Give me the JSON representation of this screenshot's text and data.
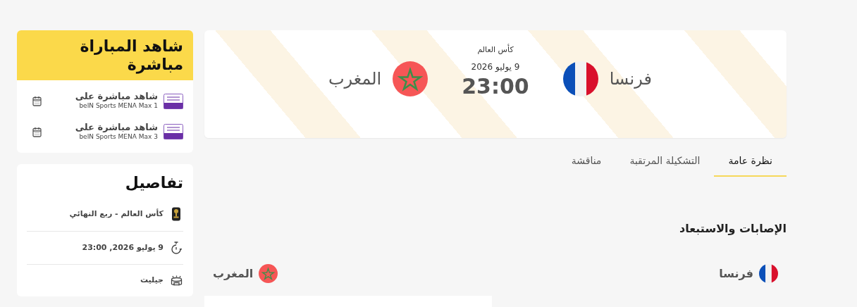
{
  "match": {
    "competition": "كأس العالم",
    "home": {
      "name": "فرنسا",
      "kind": "france"
    },
    "away": {
      "name": "المغرب",
      "kind": "morocco"
    },
    "date": "9 يوليو 2026",
    "time": "23:00"
  },
  "tabs": [
    {
      "label": "نظرة عامة",
      "selected": true
    },
    {
      "label": "التشكيلة المرتقبة",
      "selected": false
    },
    {
      "label": "مناقشة",
      "selected": false
    }
  ],
  "injuries": {
    "title": "الإصابات والاستبعاد",
    "teams": [
      {
        "name": "فرنسا",
        "kind": "france"
      },
      {
        "name": "المغرب",
        "kind": "morocco"
      }
    ]
  },
  "watch": {
    "title": "شاهد المباراة مباشرة",
    "channels": [
      {
        "title": "شاهد مباشرة على",
        "subtitle": "beIN Sports MENA Max 1"
      },
      {
        "title": "شاهد مباشرة على",
        "subtitle": "beIN Sports MENA Max 3"
      }
    ]
  },
  "details": {
    "title": "تفاصيل",
    "items": [
      {
        "kind": "competition",
        "text": "كأس العالم - ربع النهائي"
      },
      {
        "kind": "datetime",
        "text": "9 يوليو 2026, 23:00"
      },
      {
        "kind": "venue",
        "text": "جيليت"
      }
    ]
  }
}
